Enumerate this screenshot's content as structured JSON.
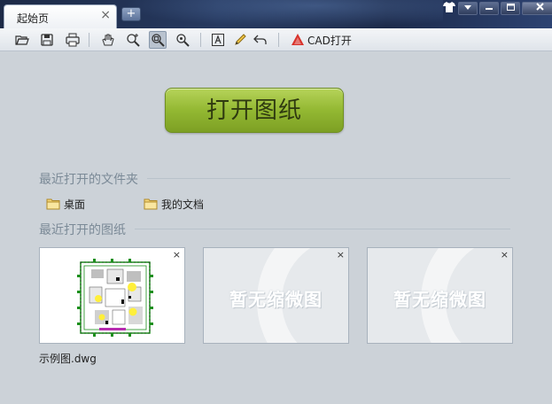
{
  "window": {
    "tab_title": "起始页",
    "tab_close": "×",
    "new_tab": "+",
    "controls": [
      "shirt",
      "dropdown",
      "minimize",
      "maximize",
      "close"
    ]
  },
  "toolbar": {
    "cad_open_label": "CAD打开"
  },
  "main": {
    "open_button_label": "打开图纸",
    "recent_folders_title": "最近打开的文件夹",
    "folders": [
      {
        "name": "桌面"
      },
      {
        "name": "我的文档"
      }
    ],
    "recent_drawings_title": "最近打开的图纸",
    "drawings": [
      {
        "caption": "示例图.dwg",
        "has_thumbnail": true
      },
      {
        "placeholder": "暂无缩微图",
        "has_thumbnail": false
      },
      {
        "placeholder": "暂无缩微图",
        "has_thumbnail": false
      }
    ],
    "close_glyph": "×"
  },
  "colors": {
    "accent_green": "#93b832",
    "titlebar": "#1d2a47",
    "background": "#ccd2d8"
  }
}
